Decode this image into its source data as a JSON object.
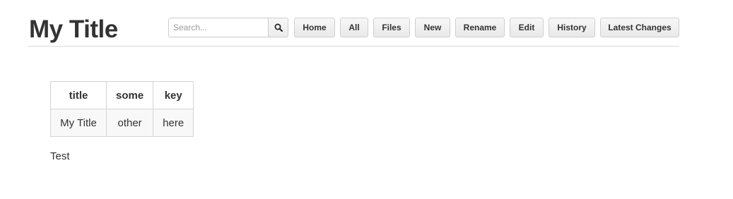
{
  "header": {
    "title": "My Title",
    "search": {
      "placeholder": "Search...",
      "value": ""
    },
    "search_icon": "magnifier-icon",
    "nav": [
      {
        "label": "Home"
      },
      {
        "label": "All"
      },
      {
        "label": "Files"
      },
      {
        "label": "New"
      },
      {
        "label": "Rename"
      },
      {
        "label": "Edit"
      },
      {
        "label": "History"
      },
      {
        "label": "Latest Changes"
      }
    ]
  },
  "metadata_table": {
    "headers": [
      "title",
      "some",
      "key"
    ],
    "rows": [
      [
        "My Title",
        "other",
        "here"
      ]
    ]
  },
  "body_text": "Test"
}
